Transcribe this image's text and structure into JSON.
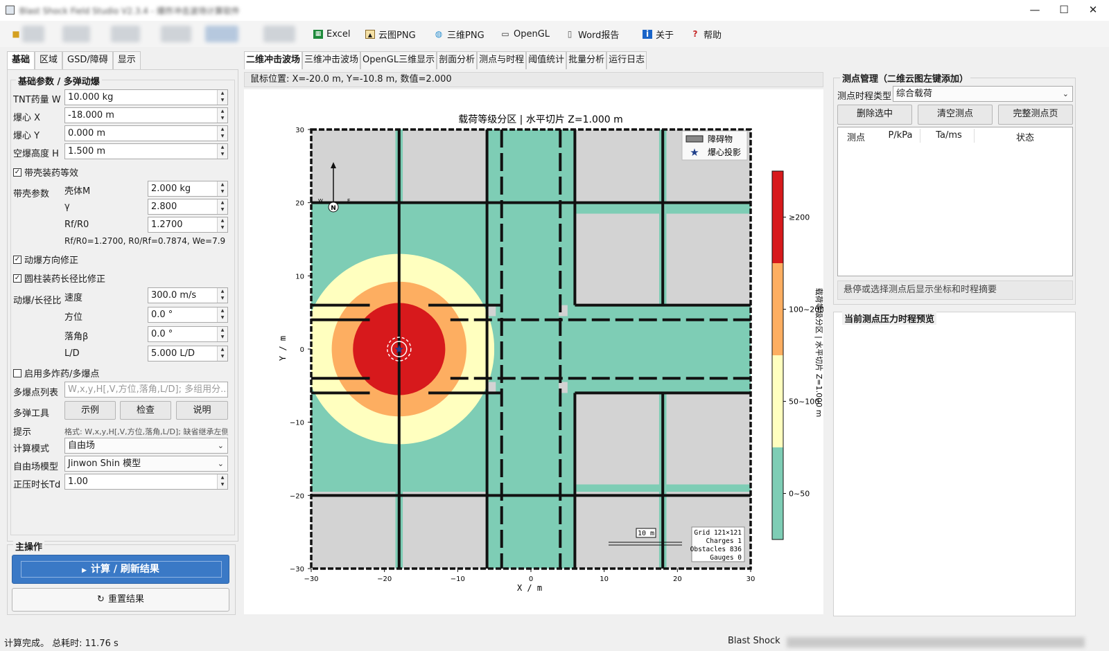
{
  "window": {
    "title": "Blast Shock Field Studio V2.3.4 - 爆炸冲击波场计算软件"
  },
  "toolbar": {
    "excel": "Excel",
    "cloud_png": "云图PNG",
    "png3d": "三维PNG",
    "opengl": "OpenGL",
    "word": "Word报告",
    "about": "关于",
    "help": "帮助"
  },
  "left_tabs": [
    "基础",
    "区域",
    "GSD/障碍",
    "显示"
  ],
  "basic": {
    "group_title": "基础参数 / 多弹动爆",
    "tnt_label": "TNT药量 W",
    "tnt_value": "10.000 kg",
    "x_label": "爆心 X",
    "x_value": "-18.000 m",
    "y_label": "爆心 Y",
    "y_value": "0.000 m",
    "h_label": "空爆高度 H",
    "h_value": "1.500 m",
    "shell_check": "带壳装药等效",
    "shell_params_label": "带壳参数",
    "shell_m_label": "壳体M",
    "shell_m_value": "2.000 kg",
    "gamma_label": "γ",
    "gamma_value": "2.800",
    "rf_label": "Rf/R0",
    "rf_value": "1.2700",
    "ratio_text": "Rf/R0=1.2700, R0/Rf=0.7874, We=7.9",
    "dyn_dir_check": "动爆方向修正",
    "cyl_check": "圆柱装药长径比修正",
    "dyn_label": "动爆/长径比",
    "speed_label": "速度",
    "speed_value": "300.0 m/s",
    "azimuth_label": "方位",
    "azimuth_value": "0.0 °",
    "fall_label": "落角β",
    "fall_value": "0.0 °",
    "ld_label": "L/D",
    "ld_value": "5.000 L/D",
    "multi_check": "启用多炸药/多爆点",
    "multi_list_label": "多爆点列表",
    "multi_list_placeholder": "W,x,y,H[,V,方位,落角,L/D]; 多组用分...",
    "multi_tool_label": "多弹工具",
    "example_btn": "示例",
    "check_btn": "检查",
    "explain_btn": "说明",
    "hint_label": "提示",
    "hint_text": "格式: W,x,y,H[,V,方位,落角,L/D]; 缺省继承左侧",
    "calc_mode_label": "计算模式",
    "calc_mode_value": "自由场",
    "free_model_label": "自由场模型",
    "free_model_value": "Jinwon Shin 模型",
    "td_label": "正压时长Td",
    "td_value": "1.00"
  },
  "main_ops": {
    "title": "主操作",
    "compute_btn": "计算 / 刷新结果",
    "reset_btn": "重置结果"
  },
  "center_tabs": [
    "二维冲击波场",
    "三维冲击波场",
    "OpenGL三维显示",
    "剖面分析",
    "测点与时程",
    "阈值统计",
    "批量分析",
    "运行日志"
  ],
  "mouse_pos": "鼠标位置: X=-20.0 m, Y=-10.8 m, 数值=2.000",
  "chart_data": {
    "type": "heatmap",
    "title": "载荷等级分区  |  水平切片 Z=1.000 m",
    "xlabel": "X / m",
    "ylabel": "Y / m",
    "xlim": [
      -30,
      30
    ],
    "ylim": [
      -30,
      30
    ],
    "x_ticks": [
      -30,
      -20,
      -10,
      0,
      10,
      20,
      30
    ],
    "y_ticks": [
      -30,
      -20,
      -10,
      0,
      10,
      20,
      30
    ],
    "legend": {
      "position": "top-right",
      "items": [
        "障碍物",
        "爆心投影"
      ]
    },
    "charge": {
      "x": -18,
      "y": 0
    },
    "levels": [
      {
        "label": "≥200",
        "color": "#d7191c"
      },
      {
        "label": "100~200",
        "color": "#fdae61"
      },
      {
        "label": "50~100",
        "color": "#ffffbf"
      },
      {
        "label": "0~50",
        "color": "#7ecdb5"
      }
    ],
    "zone_radii_m": [
      6.3,
      9.2,
      13.0
    ],
    "colorbar_label": "载荷等级分区 | 水平切片 Z=1.000 m",
    "scale_bar": "10 m",
    "info_box": [
      "Grid 121×121",
      "Charges 1",
      "Obstacles 836",
      "Gauges 0"
    ],
    "compass": {
      "n": "N",
      "w": "W",
      "e": "E"
    },
    "colors": {
      "obstacle": "#d3d3d3",
      "road": "#7ecdb5",
      "wall": "#111111"
    }
  },
  "gauges": {
    "group_title": "测点管理（二维云图左键添加）",
    "type_label": "测点时程类型",
    "type_value": "综合载荷",
    "delete_btn": "删除选中",
    "clear_btn": "清空测点",
    "full_btn": "完整测点页",
    "columns": [
      "测点",
      "P/kPa",
      "Ta/ms",
      "状态"
    ],
    "hover_tip": "悬停或选择测点后显示坐标和时程摘要",
    "preview_title": "当前测点压力时程预览"
  },
  "status": {
    "left": "计算完成。 总耗时: 11.76 s",
    "right": "Blast Shock"
  }
}
